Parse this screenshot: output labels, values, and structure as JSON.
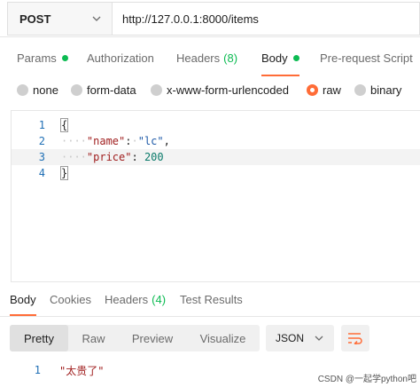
{
  "request": {
    "method": "POST",
    "url": "http://127.0.0.1:8000/items"
  },
  "request_tabs": [
    {
      "label": "Params",
      "dot": true
    },
    {
      "label": "Authorization"
    },
    {
      "label": "Headers",
      "count": "(8)"
    },
    {
      "label": "Body",
      "dot": true,
      "active": true
    },
    {
      "label": "Pre-request Script"
    }
  ],
  "body_types": [
    {
      "label": "none"
    },
    {
      "label": "form-data"
    },
    {
      "label": "x-www-form-urlencoded"
    },
    {
      "label": "raw",
      "selected": true
    },
    {
      "label": "binary"
    }
  ],
  "editor": {
    "line_numbers": [
      "1",
      "2",
      "3",
      "4"
    ],
    "l1": "{",
    "l2_indent": "····",
    "l2_key": "\"name\"",
    "l2_colon": ":",
    "l2_space": "·",
    "l2_value": "\"lc\"",
    "l2_comma": ",",
    "l3_indent": "····",
    "l3_key": "\"price\"",
    "l3_colon": ": ",
    "l3_value": "200",
    "l4": "}"
  },
  "response_tabs": [
    {
      "label": "Body",
      "active": true
    },
    {
      "label": "Cookies"
    },
    {
      "label": "Headers",
      "count": "(4)"
    },
    {
      "label": "Test Results"
    }
  ],
  "view_modes": [
    {
      "label": "Pretty",
      "active": true
    },
    {
      "label": "Raw"
    },
    {
      "label": "Preview"
    },
    {
      "label": "Visualize"
    }
  ],
  "format": "JSON",
  "response": {
    "line_number": "1",
    "value": "\"太贵了\""
  },
  "watermark": "CSDN @一起学python吧",
  "colors": {
    "accent": "#ff6c37",
    "success": "#0cbb52",
    "line_number": "#1f6fb5"
  },
  "icons": [
    "chevron-down-icon",
    "wrap-lines-icon"
  ]
}
